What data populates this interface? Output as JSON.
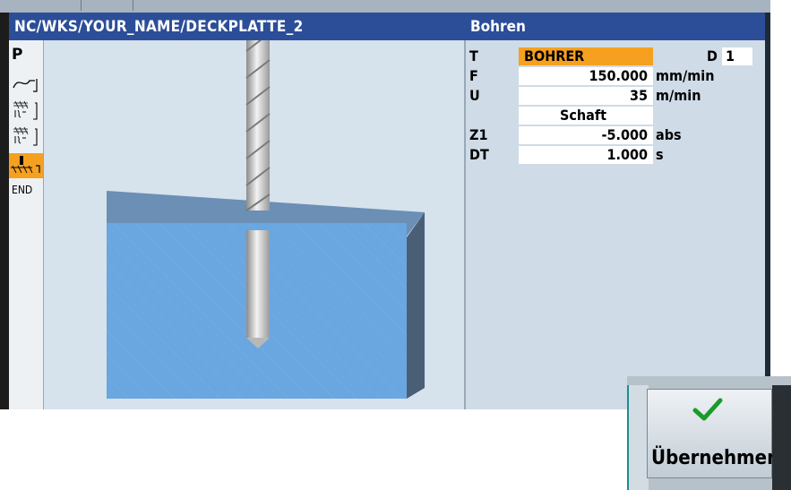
{
  "window": {
    "program_path": "NC/WKS/YOUR_NAME/DECKPLATTE_2",
    "cycle_title": "Bohren"
  },
  "left_panel": {
    "p_label": "P",
    "end_label": "END",
    "items": [
      {
        "icon": "contour-icon"
      },
      {
        "icon": "pocket-icon"
      },
      {
        "icon": "pocket-icon"
      },
      {
        "icon": "drill-cycle-icon",
        "selected": true
      }
    ]
  },
  "parameters": {
    "tool": {
      "label": "T",
      "value": "BOHRER",
      "d_label": "D",
      "d_value": "1"
    },
    "feed": {
      "label": "F",
      "value": "150.000",
      "unit": "mm/min"
    },
    "speed": {
      "label": "U",
      "value": "35",
      "unit": "m/min"
    },
    "mode": {
      "value": "Schaft"
    },
    "depth": {
      "label": "Z1",
      "value": "-5.000",
      "unit": "abs"
    },
    "dwell": {
      "label": "DT",
      "value": "1.000",
      "unit": "s"
    }
  },
  "softkeys": {
    "accept": "Übernehmen"
  },
  "colors": {
    "title_bar": "#2c4e98",
    "highlight": "#f6a020",
    "workpiece_front": "#6aa6e0",
    "background": "#cfdbe6"
  }
}
